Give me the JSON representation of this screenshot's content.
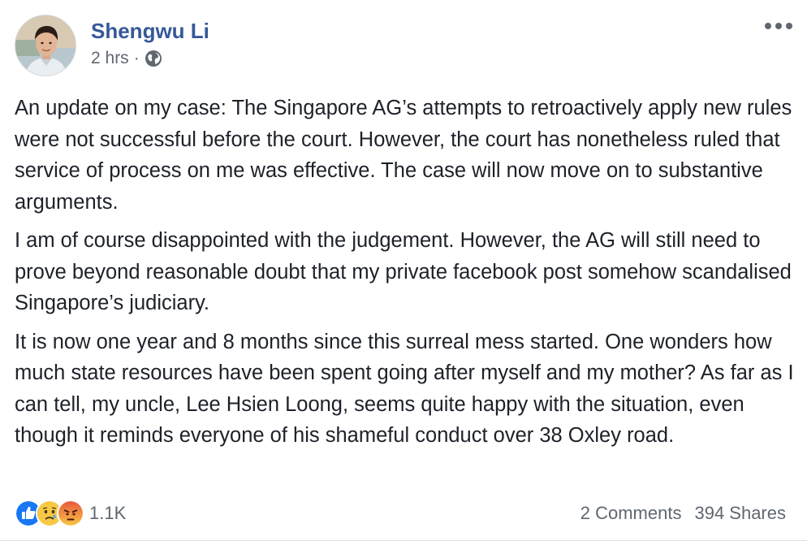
{
  "post": {
    "author": "Shengwu Li",
    "timestamp": "2 hrs",
    "separator": "·",
    "privacy_icon": "globe-icon",
    "more_icon": "more-options-icon",
    "paragraphs": [
      "An update on my case: The Singapore AG’s attempts to retroactively apply new rules were not successful before the court. However, the court has nonetheless ruled that service of process on me was effective. The case will now move on to substantive arguments.",
      "I am of course disappointed with the judgement. However, the AG will still need to prove beyond reasonable doubt that my private facebook post somehow scandalised Singapore’s judiciary.",
      "It is now one year and 8 months since this surreal mess started. One wonders how much state resources have been spent going after myself and my mother? As far as I can tell, my uncle, Lee Hsien Loong, seems quite happy with the situation, even though it reminds everyone of his shameful conduct over 38 Oxley road."
    ],
    "reactions": {
      "icons": [
        "like-reaction-icon",
        "sad-reaction-icon",
        "angry-reaction-icon"
      ],
      "count": "1.1K"
    },
    "comments": "2 Comments",
    "shares": "394 Shares"
  },
  "colors": {
    "author_link": "#365899",
    "secondary_text": "#606770",
    "body_text": "#1d2129",
    "like_blue": "#1877f2",
    "reaction_yellow": "#f7c844",
    "angry_red": "#e9573f"
  }
}
